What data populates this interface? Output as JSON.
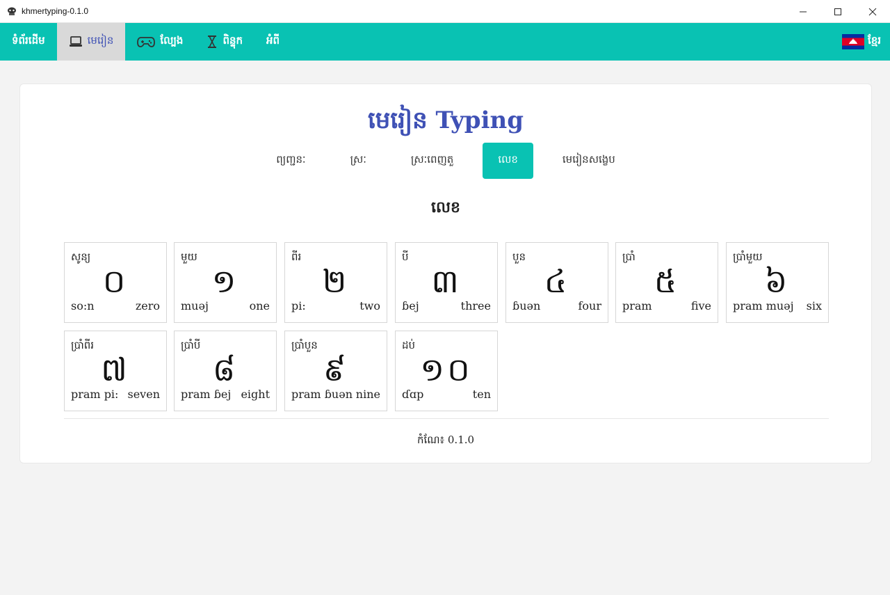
{
  "window": {
    "title": "khmertyping-0.1.0"
  },
  "nav": {
    "items": [
      {
        "label": "ទំព័រដើម",
        "icon": ""
      },
      {
        "label": "មេរៀន",
        "icon": "laptop-icon"
      },
      {
        "label": "ល្បែង",
        "icon": "gamepad-icon"
      },
      {
        "label": "ពិន្ទុក",
        "icon": "hourglass-icon"
      },
      {
        "label": "អំពី",
        "icon": ""
      }
    ],
    "active_index": 1,
    "language": "ខ្មែរ"
  },
  "page": {
    "title": "មេរៀន Typing",
    "tabs": [
      "ព្យញ្ជនៈ",
      "ស្រៈ",
      "ស្រៈពេញតួ",
      "លេខ",
      "មេរៀនសង្ខេប"
    ],
    "active_tab": 3,
    "section_title": "លេខ",
    "numbers": [
      {
        "khmer_word": "សូន្យ",
        "digit": "០",
        "romanization": "so:n",
        "english": "zero"
      },
      {
        "khmer_word": "មួយ",
        "digit": "១",
        "romanization": "muəj",
        "english": "one"
      },
      {
        "khmer_word": "ពីរ",
        "digit": "២",
        "romanization": "pi:",
        "english": "two"
      },
      {
        "khmer_word": "បី",
        "digit": "៣",
        "romanization": "ɓej",
        "english": "three"
      },
      {
        "khmer_word": "បួន",
        "digit": "៤",
        "romanization": "ɓuən",
        "english": "four"
      },
      {
        "khmer_word": "ប្រាំ",
        "digit": "៥",
        "romanization": "pram",
        "english": "five"
      },
      {
        "khmer_word": "ប្រាំមួយ",
        "digit": "៦",
        "romanization": "pram muəj",
        "english": "six"
      },
      {
        "khmer_word": "ប្រាំពីរ",
        "digit": "៧",
        "romanization": "pram pi:",
        "english": "seven"
      },
      {
        "khmer_word": "ប្រាំបី",
        "digit": "៨",
        "romanization": "pram ɓej",
        "english": "eight"
      },
      {
        "khmer_word": "ប្រាំបួន",
        "digit": "៩",
        "romanization": "pram ɓuən",
        "english": "nine"
      },
      {
        "khmer_word": "ដប់",
        "digit": "១០",
        "romanization": "ɗɑp",
        "english": "ten"
      }
    ],
    "version_label": "កំណែ៖ 0.1.0"
  },
  "colors": {
    "accent": "#09c2b3",
    "title": "#3f51b5",
    "active_nav_bg": "#d9d9d9"
  }
}
